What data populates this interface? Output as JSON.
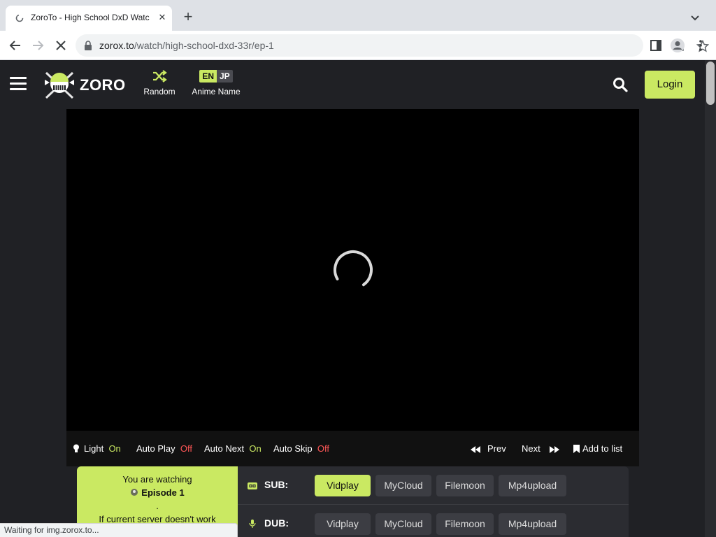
{
  "browser": {
    "tab_title": "ZoroTo - High School DxD Watch Online",
    "url_host": "zorox.to",
    "url_path": "/watch/high-school-dxd-33r/ep-1",
    "status_text": "Waiting for img.zorox.to..."
  },
  "header": {
    "logo_text": "ZORO",
    "random_label": "Random",
    "lang_en": "EN",
    "lang_jp": "JP",
    "lang_label": "Anime Name",
    "login_label": "Login"
  },
  "controls": {
    "light_label": "Light",
    "light_state": "On",
    "autoplay_label": "Auto Play",
    "autoplay_state": "Off",
    "autonext_label": "Auto Next",
    "autonext_state": "On",
    "autoskip_label": "Auto Skip",
    "autoskip_state": "Off",
    "prev_label": "Prev",
    "next_label": "Next",
    "addlist_label": "Add to list"
  },
  "watching": {
    "line1": "You are watching",
    "episode": "Episode 1",
    "dot": ".",
    "line3": "If current server doesn't work"
  },
  "servers": {
    "sub_label": "SUB:",
    "dub_label": "DUB:",
    "sub": [
      "Vidplay",
      "MyCloud",
      "Filemoon",
      "Mp4upload"
    ],
    "dub": [
      "Vidplay",
      "MyCloud",
      "Filemoon",
      "Mp4upload"
    ],
    "active_sub": "Vidplay"
  },
  "colors": {
    "accent": "#cae962",
    "off": "#ff5656",
    "background": "#202125"
  }
}
